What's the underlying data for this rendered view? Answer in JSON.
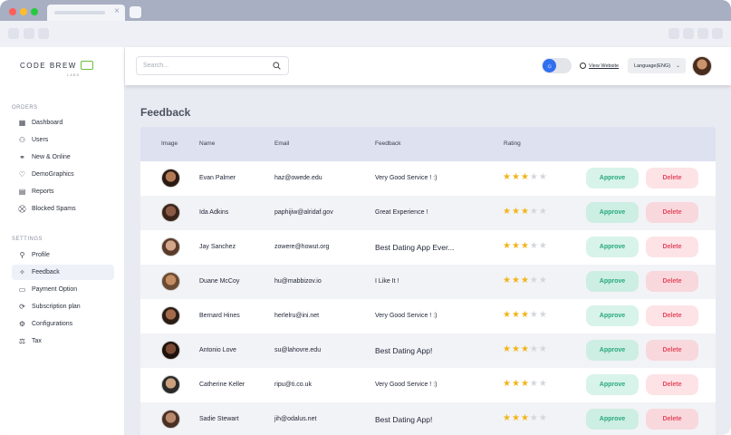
{
  "brand": {
    "name": "CODE BREW",
    "sub": "LABS"
  },
  "sidebar": {
    "orders_title": "ORDERS",
    "orders": [
      {
        "label": "Dashboard",
        "icon": "dashboard-icon"
      },
      {
        "label": "Users",
        "icon": "users-icon"
      },
      {
        "label": "New & Online",
        "icon": "new-online-icon"
      },
      {
        "label": "DemoGraphics",
        "icon": "heart-icon"
      },
      {
        "label": "Reports",
        "icon": "reports-icon"
      },
      {
        "label": "Blocked Spams",
        "icon": "blocked-icon"
      }
    ],
    "settings_title": "SETTINGS",
    "settings": [
      {
        "label": "Profile",
        "icon": "profile-icon"
      },
      {
        "label": "Feedback",
        "icon": "feedback-icon",
        "active": true
      },
      {
        "label": "Payment Option",
        "icon": "payment-icon"
      },
      {
        "label": "Subscription plan",
        "icon": "subscription-icon"
      },
      {
        "label": "Configurations",
        "icon": "config-icon"
      },
      {
        "label": "Tax",
        "icon": "tax-icon"
      }
    ]
  },
  "header": {
    "search_placeholder": "Search...",
    "view_website": "View Website",
    "language": "Language(ENG)",
    "theme_toggle_icon": "sun-icon"
  },
  "page": {
    "title": "Feedback"
  },
  "table": {
    "headers": {
      "image": "Image",
      "name": "Name",
      "email": "Email",
      "feedback": "Feedback",
      "rating": "Rating"
    },
    "approve_label": "Approve",
    "delete_label": "Delete",
    "rows": [
      {
        "name": "Evan Palmer",
        "email": "haz@owede.edu",
        "feedback": "Very Good Service ! :)",
        "rating": 3
      },
      {
        "name": "Ida Adkins",
        "email": "paphijiw@alridaf.gov",
        "feedback": "Great Experience !",
        "rating": 3
      },
      {
        "name": "Jay Sanchez",
        "email": "zowere@howut.org",
        "feedback": "Best Dating App Ever...",
        "rating": 3
      },
      {
        "name": "Duane McCoy",
        "email": "hu@mabbizov.io",
        "feedback": "I Like It !",
        "rating": 3
      },
      {
        "name": "Bernard Hines",
        "email": "herlelru@ini.net",
        "feedback": "Very Good Service ! :)",
        "rating": 3
      },
      {
        "name": "Antonio Love",
        "email": "su@lahovre.edu",
        "feedback": "Best Dating App!",
        "rating": 3
      },
      {
        "name": "Catherine Keller",
        "email": "ripu@ti.co.uk",
        "feedback": "Very Good Service ! :)",
        "rating": 3
      },
      {
        "name": "Sadie Stewart",
        "email": "jih@odalus.net",
        "feedback": "Best Dating App!",
        "rating": 3
      }
    ]
  },
  "colors": {
    "approve_text": "#27a97c",
    "delete_text": "#e5485f",
    "star": "#f2b417",
    "toggle": "#2f6ff0"
  }
}
